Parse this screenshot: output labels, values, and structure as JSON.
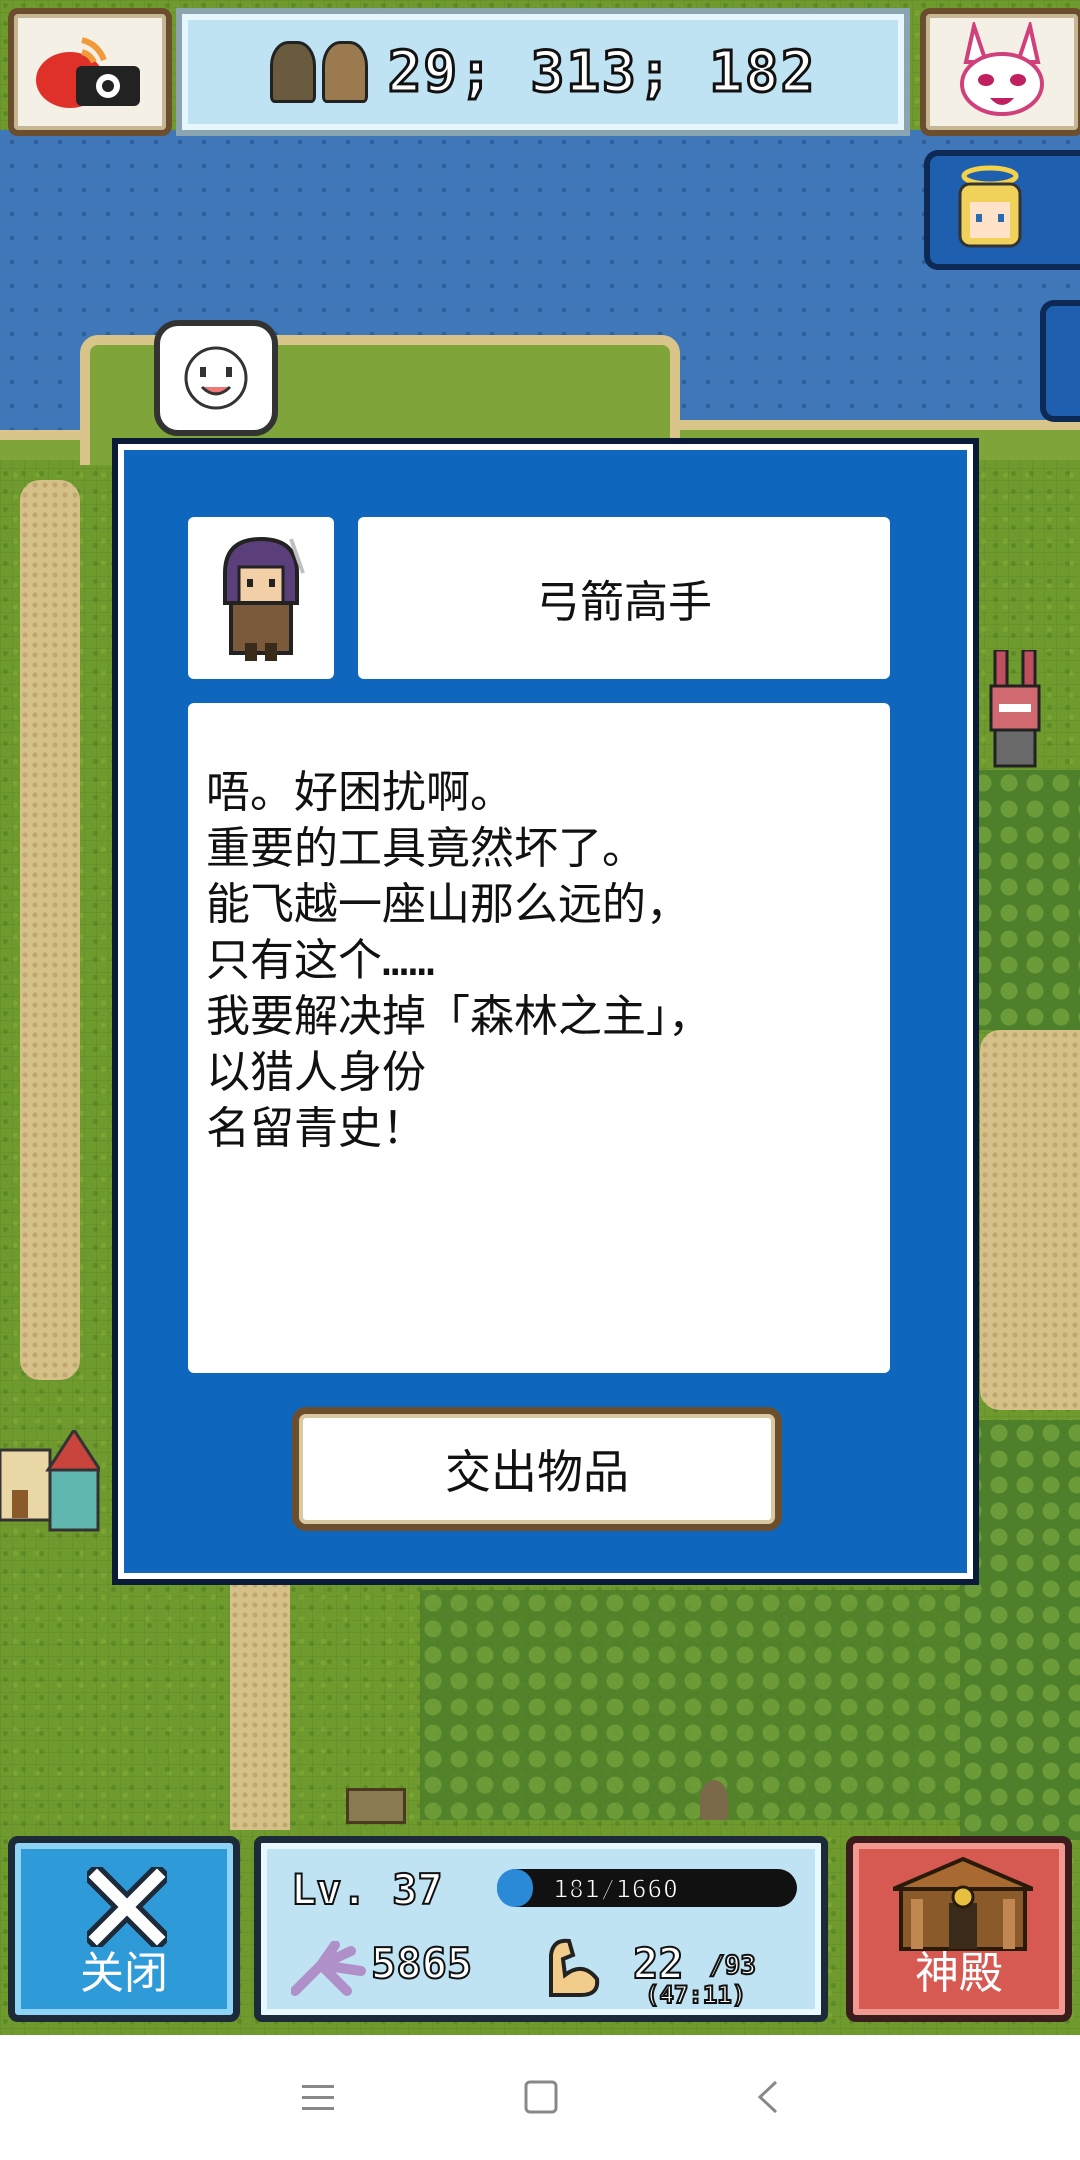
{
  "top_hud": {
    "stats": "29; 313; 182"
  },
  "dialog": {
    "npc_name": "弓箭高手",
    "lines": [
      "唔。好困扰啊。",
      "重要的工具竟然坏了。",
      "能飞越一座山那么远的，",
      "只有这个……",
      "我要解决掉「森林之主」，",
      "以猎人身份",
      "名留青史！"
    ],
    "action_label": "交出物品"
  },
  "bottom_hud": {
    "close_label": "关闭",
    "temple_label": "神殿",
    "level": "Lv. 37",
    "exp": "181/1660",
    "exp_fill": 0.109,
    "attack": "5865",
    "strength": "22",
    "strength_max": "/93",
    "strength_sub": "(47:11)"
  },
  "colors": {
    "dialog_blue": "#0f67bd",
    "close_blue": "#2f9ad8",
    "temple_red": "#d65a52",
    "sea": "#3f77b8",
    "grass": "#6f9a2e"
  },
  "icons": {
    "camera": "camera-icon",
    "rabbit": "rabbit-mask-icon",
    "close": "x-icon",
    "temple": "temple-icon",
    "attack": "claw-icon",
    "strength": "muscle-arm-icon"
  }
}
